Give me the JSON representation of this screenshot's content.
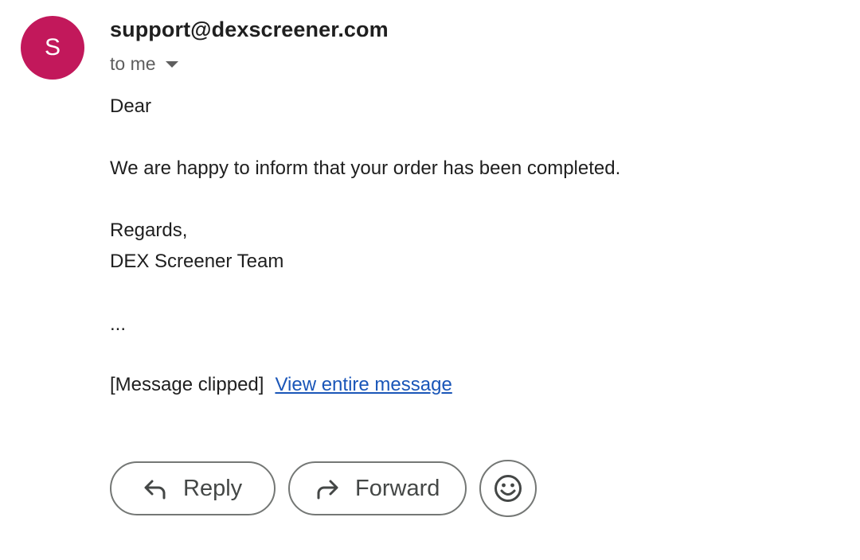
{
  "sender": {
    "avatar_letter": "S",
    "avatar_color": "#c2185b",
    "email": "support@dexscreener.com"
  },
  "recipient": {
    "label": "to me"
  },
  "message": {
    "greeting": "Dear",
    "body": "We are happy to inform that your order has been completed.",
    "closing": "Regards,",
    "signature": "DEX Screener Team",
    "ellipsis": "..."
  },
  "clipped": {
    "label": "[Message clipped]",
    "link_text": "View entire message",
    "link_color": "#1a56b8"
  },
  "actions": {
    "reply_label": "Reply",
    "forward_label": "Forward",
    "reply_icon": "reply-arrow-icon",
    "forward_icon": "forward-arrow-icon",
    "emoji_icon": "smiley-face-icon"
  }
}
